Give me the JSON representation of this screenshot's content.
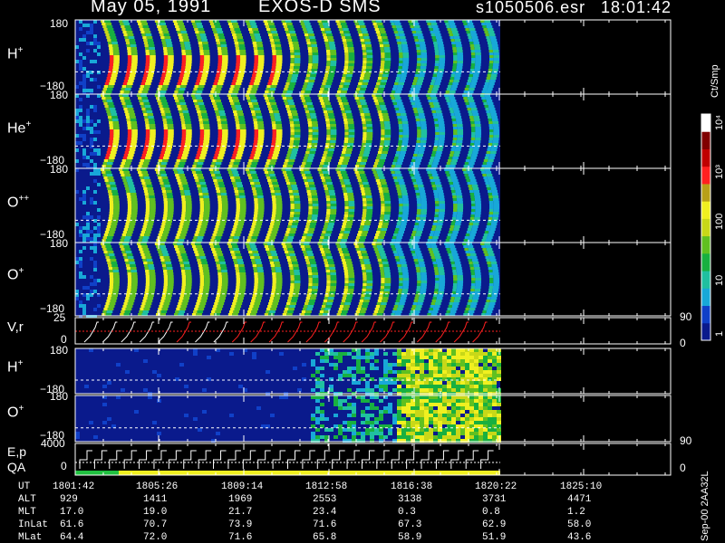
{
  "header": {
    "date": "May 05, 1991",
    "instrument": "EXOS-D SMS",
    "file": "s1050506.esr",
    "time": "18:01:42"
  },
  "colorbar": {
    "unit_label": "Ct/Smp",
    "tick_labels": [
      "1",
      "10",
      "100",
      "10³",
      "10⁴"
    ],
    "colors": [
      "#0a1a8c",
      "#1040c8",
      "#18a8d8",
      "#20c0a0",
      "#18b040",
      "#60c020",
      "#c8d818",
      "#f0f020",
      "#b8a018",
      "#ff2020",
      "#c00000",
      "#800000",
      "#ffffff"
    ]
  },
  "panels": [
    {
      "name": "H+",
      "label_main": "H",
      "label_sup": "+",
      "ymax": "180",
      "ymin": "−180"
    },
    {
      "name": "He+",
      "label_main": "He",
      "label_sup": "+",
      "ymax": "180",
      "ymin": "−180"
    },
    {
      "name": "O++",
      "label_main": "O",
      "label_sup": "++",
      "ymax": "180",
      "ymin": "−180"
    },
    {
      "name": "O+",
      "label_main": "O",
      "label_sup": "+",
      "ymax": "180",
      "ymin": "−180"
    }
  ],
  "vr_panel": {
    "label": "V,r",
    "ymax": "25",
    "ymin": "0",
    "right_top": "90",
    "right_bottom": "0"
  },
  "lower_panels": [
    {
      "name": "H+ low",
      "label_main": "H",
      "label_sup": "+",
      "ymax": "180",
      "ymin": "−180"
    },
    {
      "name": "O+ low",
      "label_main": "O",
      "label_sup": "+",
      "ymax": "180",
      "ymin": "−180",
      "right_bottom": "90"
    }
  ],
  "ep_panel": {
    "label1": "E,p",
    "label2": "QA",
    "ymax": "4000",
    "ymin": "0",
    "right_bottom": "0"
  },
  "footer_vertical": "Sep-00  2AA32L",
  "ephemeris": {
    "row_labels": [
      "UT",
      "ALT",
      "MLT",
      "InLat",
      "MLat"
    ],
    "columns": [
      [
        "1801:42",
        "929",
        "17.0",
        "61.6",
        "64.4"
      ],
      [
        "1805:26",
        "1411",
        "19.0",
        "70.7",
        "72.0"
      ],
      [
        "1809:14",
        "1969",
        "21.7",
        "73.9",
        "71.6"
      ],
      [
        "1812:58",
        "2553",
        "23.4",
        "71.6",
        "65.8"
      ],
      [
        "1816:38",
        "3138",
        "0.3",
        "67.3",
        "58.9"
      ],
      [
        "1820:22",
        "3731",
        "0.8",
        "62.9",
        "51.9"
      ],
      [
        "1825:10",
        "4471",
        "1.2",
        "58.0",
        "43.6"
      ]
    ]
  },
  "chart_data": {
    "type": "heatmap",
    "title": "May 05, 1991   EXOS-D SMS",
    "x_tick_labels": [
      "1801:42",
      "1805:26",
      "1809:14",
      "1812:58",
      "1816:38",
      "1820:22",
      "1825:10"
    ],
    "x_range_ut": [
      "1801:42",
      "1825:10"
    ],
    "y_range_deg": [
      -180,
      180
    ],
    "color_scale": "log",
    "color_range_counts": [
      1,
      10000
    ],
    "series": [
      {
        "name": "H+"
      },
      {
        "name": "He+"
      },
      {
        "name": "O++"
      },
      {
        "name": "O+"
      }
    ],
    "spin_pattern_count": 22
  }
}
